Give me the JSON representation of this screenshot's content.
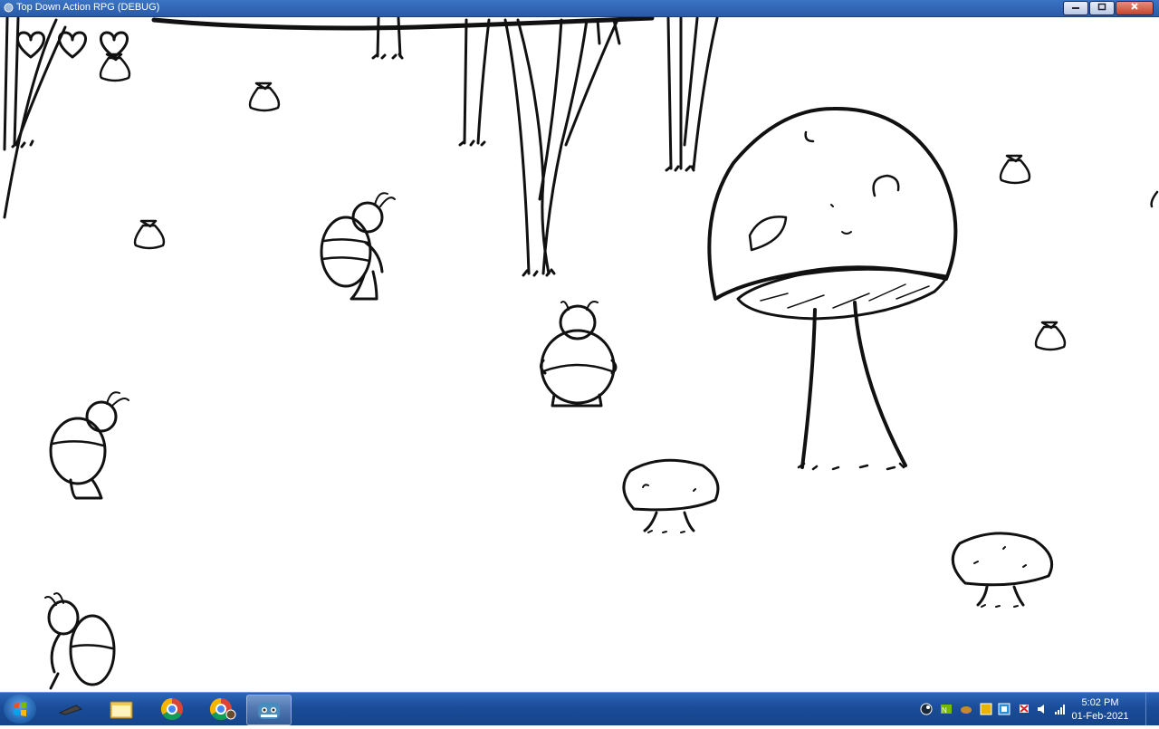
{
  "window": {
    "title": "Top Down Action RPG (DEBUG)",
    "controls": [
      "minimize",
      "maximize",
      "close"
    ]
  },
  "game": {
    "hud": {
      "hearts_full": 3,
      "hearts_total": 3
    },
    "entities": {
      "bugs": 4,
      "loot_bags": 6,
      "mushrooms": 3
    }
  },
  "taskbar": {
    "items": [
      {
        "name": "start-button",
        "icon": "windows-orb-icon"
      },
      {
        "name": "taskbar-item-app",
        "icon": "app-arrow-icon"
      },
      {
        "name": "taskbar-item-explorer",
        "icon": "folder-icon"
      },
      {
        "name": "taskbar-item-chrome",
        "icon": "chrome-icon"
      },
      {
        "name": "taskbar-item-chrome-profile",
        "icon": "chrome-profile-icon"
      },
      {
        "name": "taskbar-item-godot",
        "icon": "godot-icon",
        "active": true
      }
    ],
    "tray_icons": [
      "steam-icon",
      "nvidia-icon",
      "misc-icon",
      "wifi-icon",
      "network-icon",
      "flag-icon",
      "volume-icon",
      "signal-icon"
    ],
    "clock": {
      "time": "5:02 PM",
      "date": "01-Feb-2021"
    }
  }
}
